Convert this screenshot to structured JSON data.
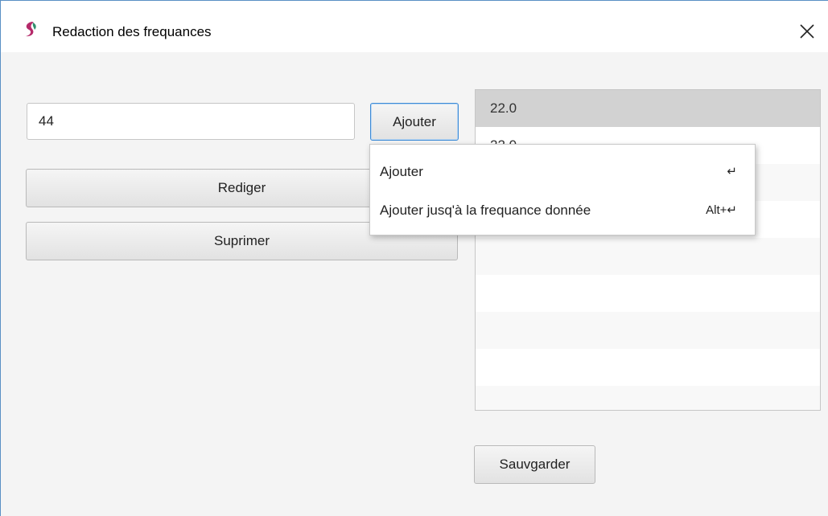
{
  "window": {
    "title": "Redaction des frequances",
    "icon": "app-logo-icon",
    "close_icon": "close-icon"
  },
  "form": {
    "frequency_value": "44",
    "add_label": "Ajouter",
    "edit_label": "Rediger",
    "delete_label": "Suprimer",
    "save_label": "Sauvgarder"
  },
  "frequency_list": {
    "items": [
      "22.0",
      "22.0"
    ],
    "selected_index": 0
  },
  "context_menu": {
    "items": [
      {
        "label": "Ajouter",
        "accelerator": "↵"
      },
      {
        "label": "Ajouter jusq'à la frequance donnée",
        "accelerator": "Alt+↵"
      }
    ]
  },
  "colors": {
    "focus_border": "#3c8ad6",
    "selected_row": "#d2d2d2",
    "window_border": "#5a8fc4"
  }
}
